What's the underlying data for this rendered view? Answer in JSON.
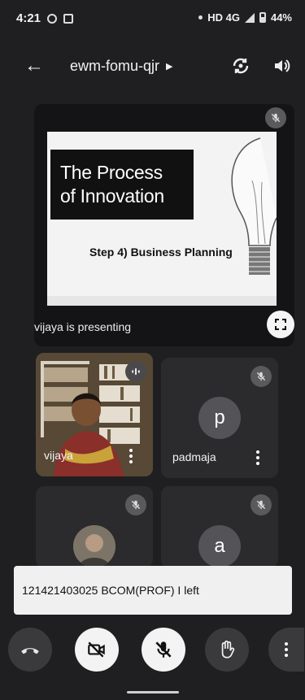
{
  "status": {
    "time": "4:21",
    "network": "HD 4G",
    "battery": "44%"
  },
  "header": {
    "title": "ewm-fomu-qjr"
  },
  "presentation": {
    "slide_title_1": "The Process",
    "slide_title_2": "of Innovation",
    "slide_subtitle": "Step 4) Business Planning",
    "presenter_label": "vijaya is presenting"
  },
  "participants": [
    {
      "name": "vijaya"
    },
    {
      "name": "padmaja",
      "initial": "p"
    },
    {
      "name": ""
    },
    {
      "initial": "a"
    }
  ],
  "toast": {
    "text": "121421403025 BCOM(PROF) I left"
  },
  "colors": {
    "background": "#1f1f21",
    "tile": "#2b2b2e",
    "badge": "#5a5a5d"
  }
}
